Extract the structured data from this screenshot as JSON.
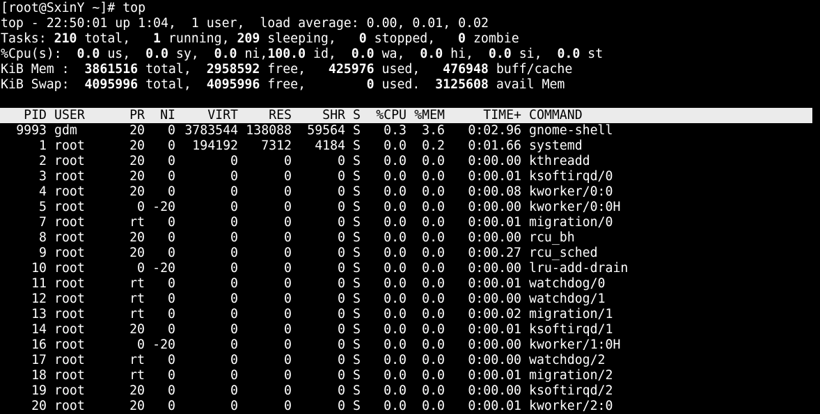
{
  "prompt": "[root@SxinY ~]# top",
  "summary": {
    "top": {
      "label": "top - ",
      "time": "22:50:01",
      "up_label": " up ",
      "uptime": "1:04",
      "users": "1",
      "users_label": " user",
      "load_label": "load average: ",
      "load": [
        "0.00",
        "0.01",
        "0.02"
      ]
    },
    "tasks": {
      "label": "Tasks:",
      "total": "210",
      "running": "1",
      "sleeping": "209",
      "stopped": "0",
      "zombie": "0"
    },
    "cpu": {
      "label": "%Cpu(s):",
      "us": "0.0",
      "sy": "0.0",
      "ni": "0.0",
      "id": "100.0",
      "wa": "0.0",
      "hi": "0.0",
      "si": "0.0",
      "st": "0.0"
    },
    "mem": {
      "label": "KiB Mem :",
      "total": "3861516",
      "free": "2958592",
      "used": "425976",
      "buff_cache": "476948"
    },
    "swap": {
      "label": "KiB Swap:",
      "total": "4095996",
      "free": "4095996",
      "used": "0",
      "avail_mem": "3125608"
    }
  },
  "columns": [
    "PID",
    "USER",
    "PR",
    "NI",
    "VIRT",
    "RES",
    "SHR",
    "S",
    "%CPU",
    "%MEM",
    "TIME+",
    "COMMAND"
  ],
  "processes": [
    {
      "pid": "9993",
      "user": "gdm",
      "pr": "20",
      "ni": "0",
      "virt": "3783544",
      "res": "138088",
      "shr": "59564",
      "s": "S",
      "cpu": "0.3",
      "mem": "3.6",
      "time": "0:02.96",
      "cmd": "gnome-shell"
    },
    {
      "pid": "1",
      "user": "root",
      "pr": "20",
      "ni": "0",
      "virt": "194192",
      "res": "7312",
      "shr": "4184",
      "s": "S",
      "cpu": "0.0",
      "mem": "0.2",
      "time": "0:01.66",
      "cmd": "systemd"
    },
    {
      "pid": "2",
      "user": "root",
      "pr": "20",
      "ni": "0",
      "virt": "0",
      "res": "0",
      "shr": "0",
      "s": "S",
      "cpu": "0.0",
      "mem": "0.0",
      "time": "0:00.00",
      "cmd": "kthreadd"
    },
    {
      "pid": "3",
      "user": "root",
      "pr": "20",
      "ni": "0",
      "virt": "0",
      "res": "0",
      "shr": "0",
      "s": "S",
      "cpu": "0.0",
      "mem": "0.0",
      "time": "0:00.01",
      "cmd": "ksoftirqd/0"
    },
    {
      "pid": "4",
      "user": "root",
      "pr": "20",
      "ni": "0",
      "virt": "0",
      "res": "0",
      "shr": "0",
      "s": "S",
      "cpu": "0.0",
      "mem": "0.0",
      "time": "0:00.08",
      "cmd": "kworker/0:0"
    },
    {
      "pid": "5",
      "user": "root",
      "pr": "0",
      "ni": "-20",
      "virt": "0",
      "res": "0",
      "shr": "0",
      "s": "S",
      "cpu": "0.0",
      "mem": "0.0",
      "time": "0:00.00",
      "cmd": "kworker/0:0H"
    },
    {
      "pid": "7",
      "user": "root",
      "pr": "rt",
      "ni": "0",
      "virt": "0",
      "res": "0",
      "shr": "0",
      "s": "S",
      "cpu": "0.0",
      "mem": "0.0",
      "time": "0:00.01",
      "cmd": "migration/0"
    },
    {
      "pid": "8",
      "user": "root",
      "pr": "20",
      "ni": "0",
      "virt": "0",
      "res": "0",
      "shr": "0",
      "s": "S",
      "cpu": "0.0",
      "mem": "0.0",
      "time": "0:00.00",
      "cmd": "rcu_bh"
    },
    {
      "pid": "9",
      "user": "root",
      "pr": "20",
      "ni": "0",
      "virt": "0",
      "res": "0",
      "shr": "0",
      "s": "S",
      "cpu": "0.0",
      "mem": "0.0",
      "time": "0:00.27",
      "cmd": "rcu_sched"
    },
    {
      "pid": "10",
      "user": "root",
      "pr": "0",
      "ni": "-20",
      "virt": "0",
      "res": "0",
      "shr": "0",
      "s": "S",
      "cpu": "0.0",
      "mem": "0.0",
      "time": "0:00.00",
      "cmd": "lru-add-drain"
    },
    {
      "pid": "11",
      "user": "root",
      "pr": "rt",
      "ni": "0",
      "virt": "0",
      "res": "0",
      "shr": "0",
      "s": "S",
      "cpu": "0.0",
      "mem": "0.0",
      "time": "0:00.01",
      "cmd": "watchdog/0"
    },
    {
      "pid": "12",
      "user": "root",
      "pr": "rt",
      "ni": "0",
      "virt": "0",
      "res": "0",
      "shr": "0",
      "s": "S",
      "cpu": "0.0",
      "mem": "0.0",
      "time": "0:00.00",
      "cmd": "watchdog/1"
    },
    {
      "pid": "13",
      "user": "root",
      "pr": "rt",
      "ni": "0",
      "virt": "0",
      "res": "0",
      "shr": "0",
      "s": "S",
      "cpu": "0.0",
      "mem": "0.0",
      "time": "0:00.02",
      "cmd": "migration/1"
    },
    {
      "pid": "14",
      "user": "root",
      "pr": "20",
      "ni": "0",
      "virt": "0",
      "res": "0",
      "shr": "0",
      "s": "S",
      "cpu": "0.0",
      "mem": "0.0",
      "time": "0:00.01",
      "cmd": "ksoftirqd/1"
    },
    {
      "pid": "16",
      "user": "root",
      "pr": "0",
      "ni": "-20",
      "virt": "0",
      "res": "0",
      "shr": "0",
      "s": "S",
      "cpu": "0.0",
      "mem": "0.0",
      "time": "0:00.00",
      "cmd": "kworker/1:0H"
    },
    {
      "pid": "17",
      "user": "root",
      "pr": "rt",
      "ni": "0",
      "virt": "0",
      "res": "0",
      "shr": "0",
      "s": "S",
      "cpu": "0.0",
      "mem": "0.0",
      "time": "0:00.00",
      "cmd": "watchdog/2"
    },
    {
      "pid": "18",
      "user": "root",
      "pr": "rt",
      "ni": "0",
      "virt": "0",
      "res": "0",
      "shr": "0",
      "s": "S",
      "cpu": "0.0",
      "mem": "0.0",
      "time": "0:00.01",
      "cmd": "migration/2"
    },
    {
      "pid": "19",
      "user": "root",
      "pr": "20",
      "ni": "0",
      "virt": "0",
      "res": "0",
      "shr": "0",
      "s": "S",
      "cpu": "0.0",
      "mem": "0.0",
      "time": "0:00.00",
      "cmd": "ksoftirqd/2"
    },
    {
      "pid": "20",
      "user": "root",
      "pr": "20",
      "ni": "0",
      "virt": "0",
      "res": "0",
      "shr": "0",
      "s": "S",
      "cpu": "0.0",
      "mem": "0.0",
      "time": "0:00.01",
      "cmd": "kworker/2:0"
    }
  ]
}
